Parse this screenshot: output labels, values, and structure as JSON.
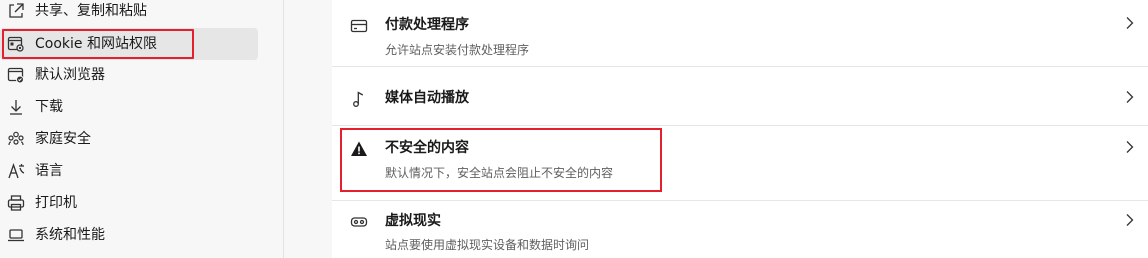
{
  "sidebar": {
    "items": [
      {
        "label": "共享、复制和粘贴",
        "icon": "share-icon"
      },
      {
        "label": "Cookie 和网站权限",
        "icon": "site-permissions-icon",
        "selected": true
      },
      {
        "label": "默认浏览器",
        "icon": "default-browser-icon"
      },
      {
        "label": "下载",
        "icon": "download-icon"
      },
      {
        "label": "家庭安全",
        "icon": "family-icon"
      },
      {
        "label": "语言",
        "icon": "language-icon"
      },
      {
        "label": "打印机",
        "icon": "printer-icon"
      },
      {
        "label": "系统和性能",
        "icon": "laptop-icon"
      }
    ]
  },
  "main": {
    "rows": [
      {
        "title": "付款处理程序",
        "desc": "允许站点安装付款处理程序",
        "icon": "card-icon"
      },
      {
        "title": "媒体自动播放",
        "desc": "",
        "icon": "music-note-icon"
      },
      {
        "title": "不安全的内容",
        "desc": "默认情况下，安全站点会阻止不安全的内容",
        "icon": "warning-icon"
      },
      {
        "title": "虚拟现实",
        "desc": "站点要使用虚拟现实设备和数据时询问",
        "icon": "vr-headset-icon"
      }
    ]
  },
  "colors": {
    "highlight": "#e5202e",
    "sidebar_bg": "#f7f7f7",
    "selected_bg": "#e6e6e6",
    "card_bg": "#ffffff"
  }
}
